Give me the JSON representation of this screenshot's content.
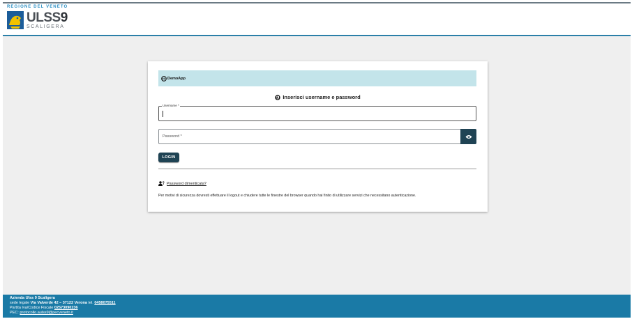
{
  "header": {
    "region": "REGIONE DEL VENETO",
    "logo_ulss": "ULSS",
    "logo_num": "9",
    "logo_sub": "SCALIGERA"
  },
  "card": {
    "app_icon": "globe-icon",
    "app_name": "DemoApp",
    "title_icon": "shield-icon",
    "title": "Inserisci username e password",
    "username_label": "Username *",
    "username_value": "",
    "password_placeholder": "Password *",
    "eye_icon": "eye-icon",
    "login_label": "LOGIN",
    "forgot_icon": "user-key-icon",
    "forgot_label": "Password dimenticata?",
    "notice": "Per motivi di sicurezza dovresti effettuare il logout e chiudere tutte le finestre del browser quando hai finito di utilizzare servizi che necessitano autenticazione."
  },
  "footer": {
    "company": "Azienda Ulss 9 Scaligera",
    "sede_prefix": "sede legale",
    "sede_address": "Via Valverde 42 – 37122 Verona",
    "tel_prefix": "tel.",
    "tel": "0458075511",
    "piva_prefix": "Partita Iva/Codice Fiscale",
    "piva": "02573090236",
    "pec_prefix": "PEC:",
    "pec": "protocollo.aulss9@pecveneto.it"
  },
  "colors": {
    "header_rule": "#2b7fa8",
    "banner_bg": "#c3e4ea",
    "button_bg": "#1f4354",
    "footer_bg": "#1a7aa6",
    "page_bg": "#efefef"
  }
}
